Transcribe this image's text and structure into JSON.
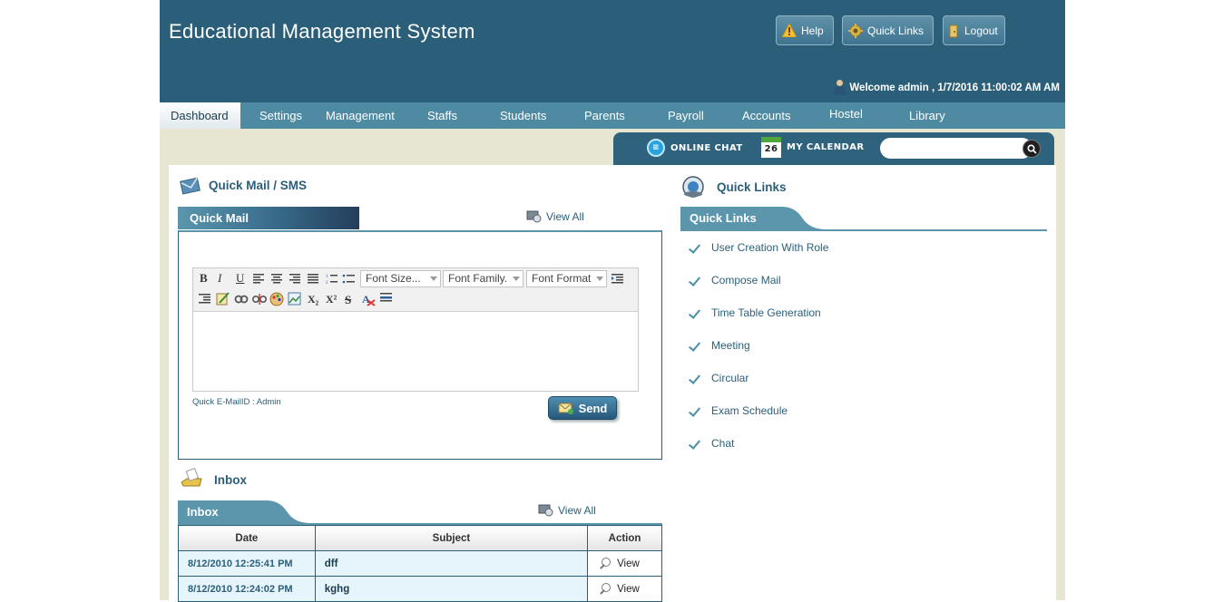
{
  "header": {
    "title": "Educational Management System",
    "buttons": {
      "help": "Help",
      "quick_links": "Quick Links",
      "logout": "Logout"
    },
    "welcome": "Welcome admin , 1/7/2016 11:00:02 AM AM"
  },
  "nav": {
    "items": [
      "Dashboard",
      "Settings",
      "Management",
      "Staffs",
      "Students",
      "Parents",
      "Payroll",
      "Accounts",
      "Hostel",
      "Library"
    ],
    "active": "Dashboard"
  },
  "subbar": {
    "online_chat": "ONLINE CHAT",
    "calendar": "MY CALENDAR",
    "calendar_day": "26",
    "search_placeholder": ""
  },
  "quick_mail": {
    "section_title": "Quick Mail / SMS",
    "tab_label": "Quick Mail",
    "view_all": "View All",
    "toolbar": {
      "bold": "B",
      "italic": "I",
      "underline": "U",
      "font_size": "Font Size...",
      "font_family": "Font Family.",
      "font_format": "Font Format",
      "subscript": "X₂",
      "superscript": "X²",
      "strike": "S"
    },
    "quick_email_id": "Quick E-MailID : Admin",
    "send": "Send"
  },
  "quick_links": {
    "section_title": "Quick Links",
    "tab_label": "Quick Links",
    "items": [
      "User Creation With Role",
      "Compose Mail",
      "Time Table Generation",
      "Meeting",
      "Circular",
      "Exam Schedule",
      "Chat"
    ]
  },
  "inbox": {
    "section_title": "Inbox",
    "tab_label": "Inbox",
    "view_all": "View All",
    "columns": [
      "Date",
      "Subject",
      "Action"
    ],
    "rows": [
      {
        "date": "8/12/2010 12:25:41 PM",
        "subject": "dff",
        "action": "View"
      },
      {
        "date": "8/12/2010 12:24:02 PM",
        "subject": "kghg",
        "action": "View"
      }
    ]
  },
  "colors": {
    "header": "#2b5f79",
    "nav": "#4f8aa3",
    "accent": "#2b5f79",
    "page_bg": "#e6e6d2"
  }
}
